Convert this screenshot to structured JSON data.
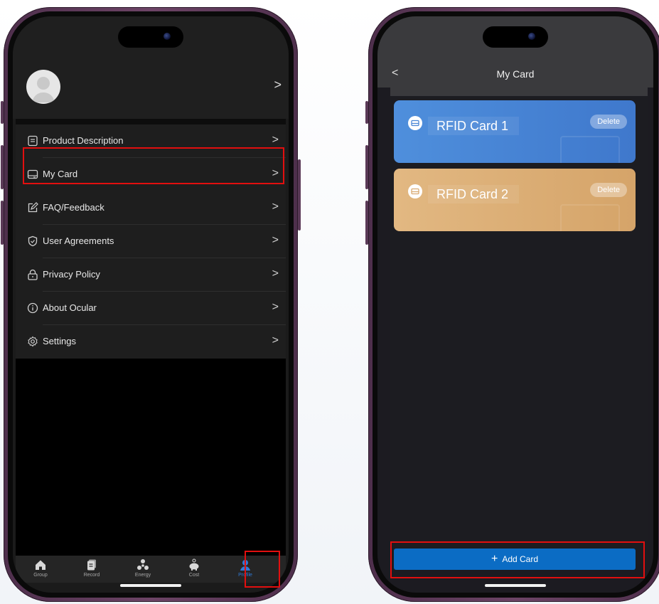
{
  "left_screen": {
    "menu": [
      {
        "label": "Product Description",
        "icon": "document-icon"
      },
      {
        "label": "My Card",
        "icon": "card-icon"
      },
      {
        "label": "FAQ/Feedback",
        "icon": "edit-icon"
      },
      {
        "label": "User Agreements",
        "icon": "shield-check-icon"
      },
      {
        "label": "Privacy Policy",
        "icon": "lock-icon"
      },
      {
        "label": "About Ocular",
        "icon": "info-icon"
      },
      {
        "label": "Settings",
        "icon": "gear-icon"
      }
    ],
    "tabs": [
      {
        "label": "Group",
        "icon": "home-icon"
      },
      {
        "label": "Record",
        "icon": "record-icon"
      },
      {
        "label": "Energy",
        "icon": "energy-icon"
      },
      {
        "label": "Cost",
        "icon": "piggy-bank-icon"
      },
      {
        "label": "Profile",
        "icon": "profile-icon",
        "active": true
      }
    ],
    "chevron": ">"
  },
  "right_screen": {
    "title": "My Card",
    "back": "<",
    "cards": [
      {
        "name": "RFID Card 1",
        "delete_label": "Delete",
        "color": "#4a86d6"
      },
      {
        "name": "RFID Card 2",
        "delete_label": "Delete",
        "color": "#d9aa72"
      }
    ],
    "add_button": {
      "plus": "+",
      "label": "Add Card"
    }
  },
  "colors": {
    "highlight": "#e20f0f",
    "active_tab": "#2f7ad8",
    "button_blue": "#0b6cc4",
    "phone_frame": "#5a3957"
  }
}
